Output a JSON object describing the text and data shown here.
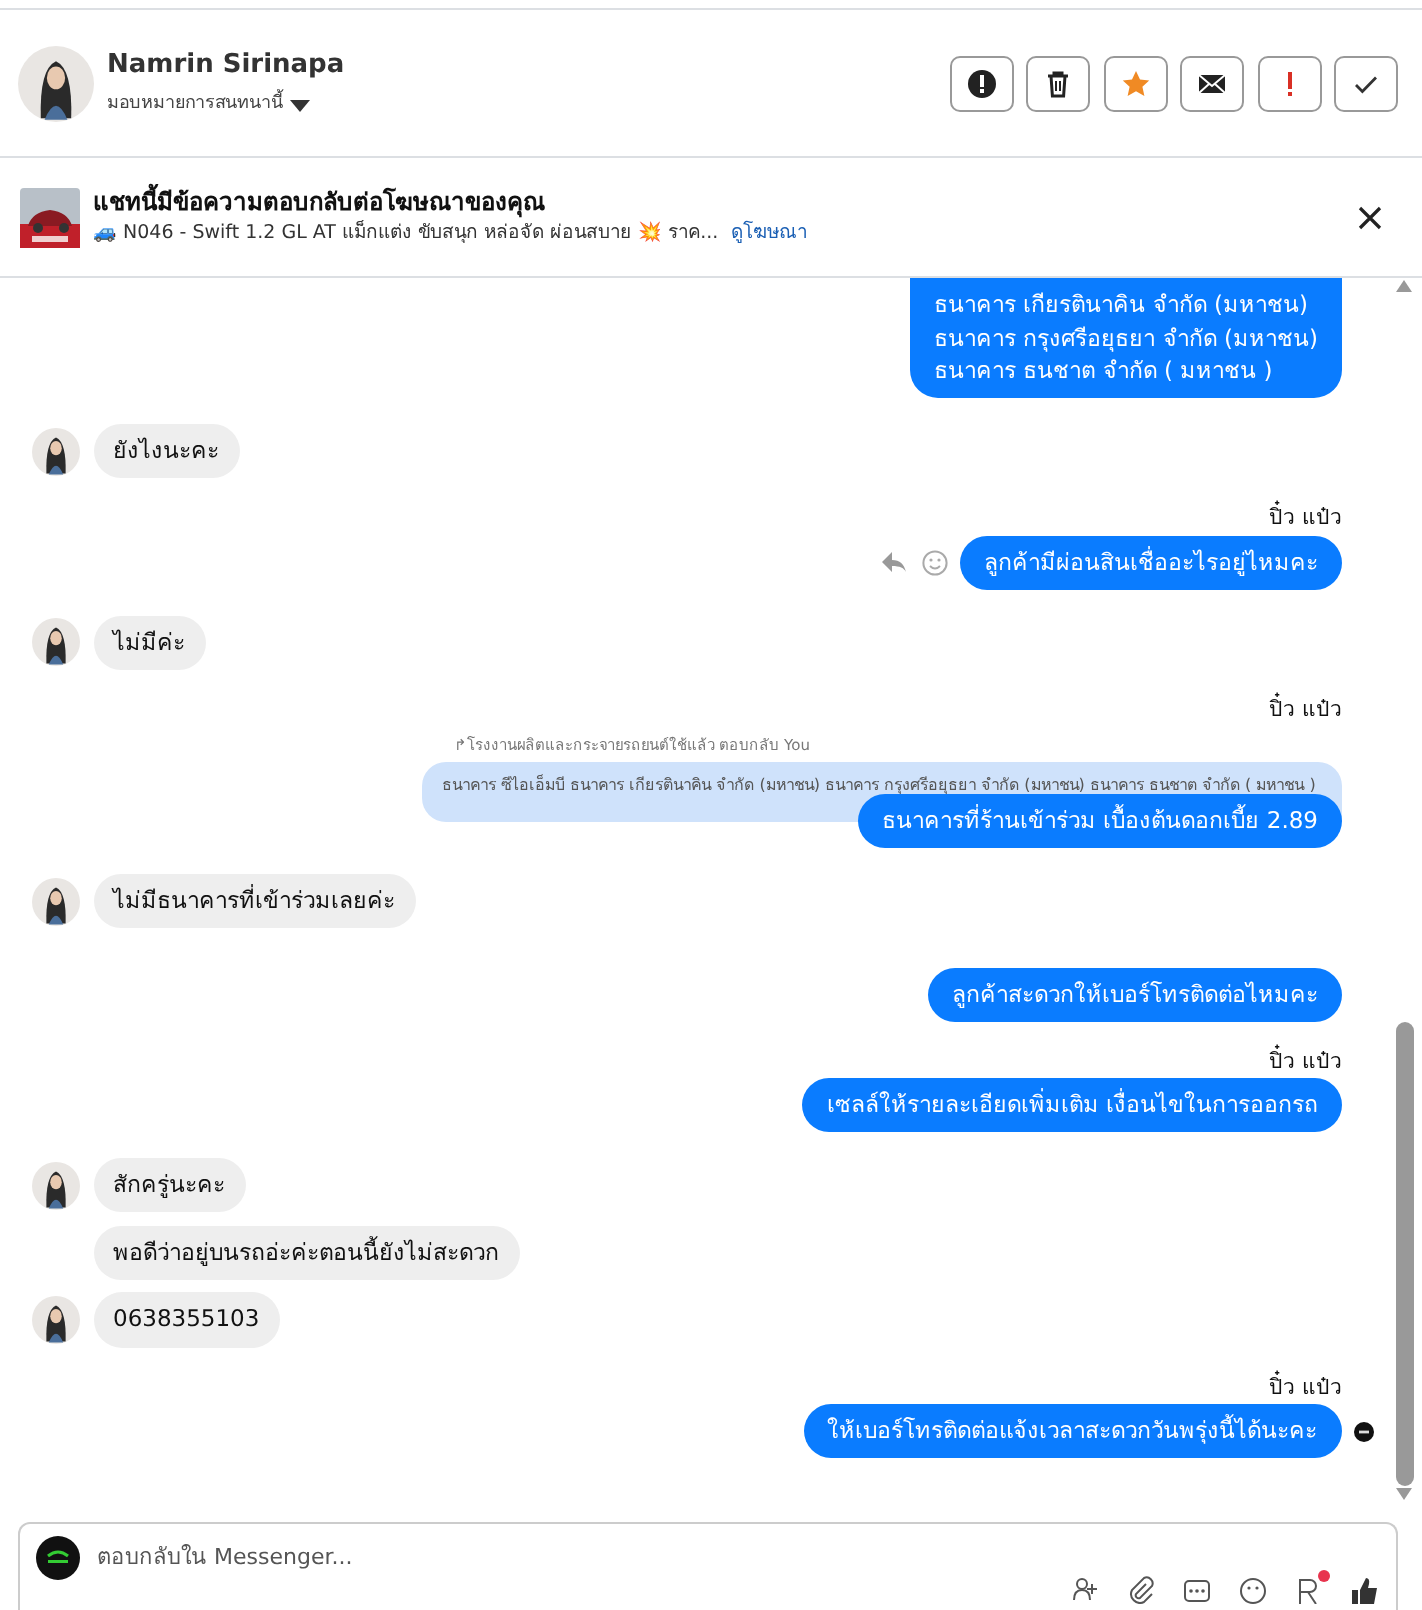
{
  "header": {
    "name": "Namrin Sirinapa",
    "assign_label": "มอบหมายการสนทนานี้",
    "buttons": [
      {
        "kind": "alert"
      },
      {
        "kind": "trash"
      },
      {
        "kind": "star"
      },
      {
        "kind": "mail"
      },
      {
        "kind": "urgent"
      },
      {
        "kind": "done"
      }
    ]
  },
  "ad_banner": {
    "title": "แชทนี้มีข้อความตอบกลับต่อโฆษณาของคุณ",
    "subtitle": "🚙 N046 - Swift 1.2 GL AT แม็กแต่ง ขับสนุก หล่อจัด ผ่อนสบาย 💥 ราค...",
    "link": "ดูโฆษณา"
  },
  "messages": [
    {
      "kind": "outgoing",
      "lines": [
        "ธนาคาร เกียรตินาคิน จำกัด (มหาชน)",
        "ธนาคาร กรุงศรีอยุธยา จำกัด (มหาชน)",
        "ธนาคาร ธนชาต จำกัด ( มหาชน )"
      ]
    },
    {
      "kind": "incoming",
      "lines": [
        "ยังไงนะคะ"
      ],
      "avatar": true
    },
    {
      "kind": "sender",
      "text": "ปิ๋ว แป๋ว"
    },
    {
      "kind": "outgoing",
      "lines": [
        "ลูกค้ามีผ่อนสินเชื่ออะไรอยู่ไหมคะ"
      ],
      "hover_actions": true
    },
    {
      "kind": "incoming",
      "lines": [
        "ไม่มีค่ะ"
      ],
      "avatar": true
    },
    {
      "kind": "sender",
      "text": "ปิ๋ว แป๋ว"
    },
    {
      "kind": "outgoing",
      "lines": [
        "ธนาคารที่ร้านเข้าร่วม เบื้องต้นดอกเบี้ย 2.89"
      ],
      "reply_to": {
        "label": "↱โรงงานผลิตและกระจายรถยนต์ใช้แล้ว ตอบกลับ You",
        "text": "ธนาคาร ซีไอเอ็มบี ธนาคาร เกียรตินาคิน จำกัด (มหาชน) ธนาคาร กรุงศรีอยุธยา จำกัด (มหาชน) ธนาคาร ธนชาต จำกัด ( มหาชน )"
      }
    },
    {
      "kind": "incoming",
      "lines": [
        "ไม่มีธนาคารที่เข้าร่วมเลยค่ะ"
      ],
      "avatar": true
    },
    {
      "kind": "outgoing",
      "lines": [
        "ลูกค้าสะดวกให้เบอร์โทรติดต่อไหมคะ"
      ]
    },
    {
      "kind": "sender",
      "text": "ปิ๋ว แป๋ว"
    },
    {
      "kind": "outgoing",
      "lines": [
        "เซลล์ให้รายละเอียดเพิ่มเติม เงื่อนไขในการออกรถ"
      ]
    },
    {
      "kind": "incoming",
      "lines": [
        "สักครู่นะคะ"
      ],
      "avatar": true
    },
    {
      "kind": "incoming",
      "lines": [
        "พอดีว่าอยู่บนรถอ่ะค่ะตอนนี้ยังไม่สะดวก"
      ],
      "avatar": false
    },
    {
      "kind": "incoming",
      "lines": [
        "0638355103"
      ],
      "avatar": true
    },
    {
      "kind": "sender",
      "text": "ปิ๋ว แป๋ว"
    },
    {
      "kind": "outgoing",
      "lines": [
        "ให้เบอร์โทรติดต่อแจ้งเวลาสะดวกวันพรุ่งนี้ได้นะคะ"
      ],
      "seen": true
    }
  ],
  "composer": {
    "placeholder": "ตอบกลับใน Messenger...",
    "tools": [
      {
        "kind": "person-add"
      },
      {
        "kind": "clip"
      },
      {
        "kind": "dots"
      },
      {
        "kind": "emoji"
      },
      {
        "kind": "tag",
        "badge": true
      },
      {
        "kind": "like"
      }
    ]
  }
}
